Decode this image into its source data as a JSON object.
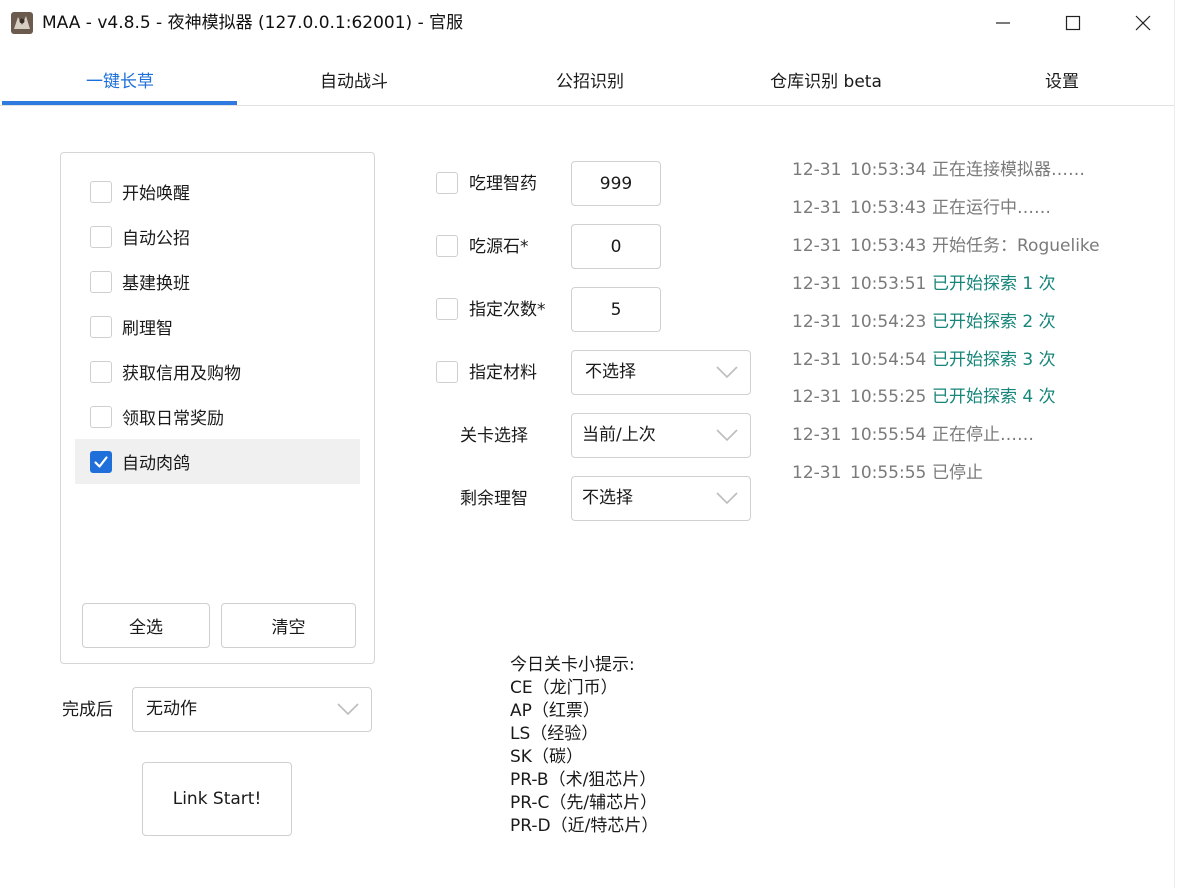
{
  "window": {
    "title": "MAA - v4.8.5 - 夜神模拟器 (127.0.0.1:62001) - 官服",
    "icon": "maa-app-icon"
  },
  "tabs": [
    {
      "label": "一键长草",
      "active": true
    },
    {
      "label": "自动战斗",
      "active": false
    },
    {
      "label": "公招识别",
      "active": false
    },
    {
      "label": "仓库识别 beta",
      "active": false
    },
    {
      "label": "设置",
      "active": false
    }
  ],
  "tasks": [
    {
      "label": "开始唤醒",
      "checked": false
    },
    {
      "label": "自动公招",
      "checked": false
    },
    {
      "label": "基建换班",
      "checked": false
    },
    {
      "label": "刷理智",
      "checked": false
    },
    {
      "label": "获取信用及购物",
      "checked": false
    },
    {
      "label": "领取日常奖励",
      "checked": false
    },
    {
      "label": "自动肉鸽",
      "checked": true
    }
  ],
  "task_buttons": {
    "select_all": "全选",
    "clear": "清空"
  },
  "after_finish": {
    "label": "完成后",
    "value": "无动作"
  },
  "start_button": "Link Start!",
  "options": {
    "medicine": {
      "label": "吃理智药",
      "value": "999",
      "checked": false
    },
    "stone": {
      "label": "吃源石*",
      "value": "0",
      "checked": false
    },
    "times": {
      "label": "指定次数*",
      "value": "5",
      "checked": false
    },
    "material": {
      "label": "指定材料",
      "value": "不选择",
      "checked": false
    },
    "stage": {
      "label": "关卡选择",
      "value": "当前/上次"
    },
    "remaining": {
      "label": "剩余理智",
      "value": "不选择"
    }
  },
  "logs": [
    {
      "date": "12-31",
      "time": "10:53:34",
      "msg": "正在连接模拟器……",
      "status": "info"
    },
    {
      "date": "12-31",
      "time": "10:53:43",
      "msg": "正在运行中……",
      "status": "info"
    },
    {
      "date": "12-31",
      "time": "10:53:43",
      "msg": "开始任务：Roguelike",
      "status": "info"
    },
    {
      "date": "12-31",
      "time": "10:53:51",
      "msg": "已开始探索 1 次",
      "status": "ok"
    },
    {
      "date": "12-31",
      "time": "10:54:23",
      "msg": "已开始探索 2 次",
      "status": "ok"
    },
    {
      "date": "12-31",
      "time": "10:54:54",
      "msg": "已开始探索 3 次",
      "status": "ok"
    },
    {
      "date": "12-31",
      "time": "10:55:25",
      "msg": "已开始探索 4 次",
      "status": "ok"
    },
    {
      "date": "12-31",
      "time": "10:55:54",
      "msg": "正在停止……",
      "status": "info"
    },
    {
      "date": "12-31",
      "time": "10:55:55",
      "msg": "已停止",
      "status": "info"
    }
  ],
  "tips": {
    "title": "今日关卡小提示:",
    "lines": [
      "CE（龙门币）",
      "AP（红票）",
      "LS（经验）",
      "SK（碳）",
      "PR-B（术/狙芯片）",
      "PR-C（先/辅芯片）",
      "PR-D（近/特芯片）"
    ]
  },
  "colors": {
    "accent": "#1e6fd9",
    "log_ok": "#16857a",
    "log_info": "#7a7a7a"
  }
}
